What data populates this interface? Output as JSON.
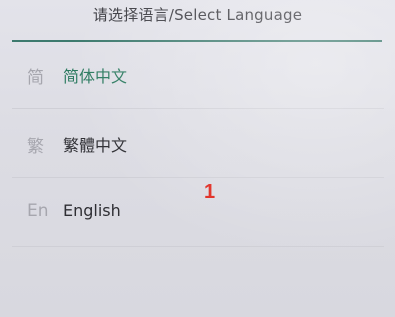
{
  "dialog": {
    "title": "请选择语言/Select Language"
  },
  "languages": [
    {
      "icon_text": "简",
      "label": "简体中文",
      "selected": true
    },
    {
      "icon_text": "繁",
      "label": "繁體中文",
      "selected": false
    },
    {
      "icon_text": "En",
      "label": "English",
      "selected": false
    }
  ],
  "annotation": {
    "marker": "1",
    "color": "#e0261c"
  },
  "colors": {
    "accent": "#3d7a6e",
    "selected_text": "#2b7a5f",
    "icon_gray": "#a6a6ae"
  }
}
